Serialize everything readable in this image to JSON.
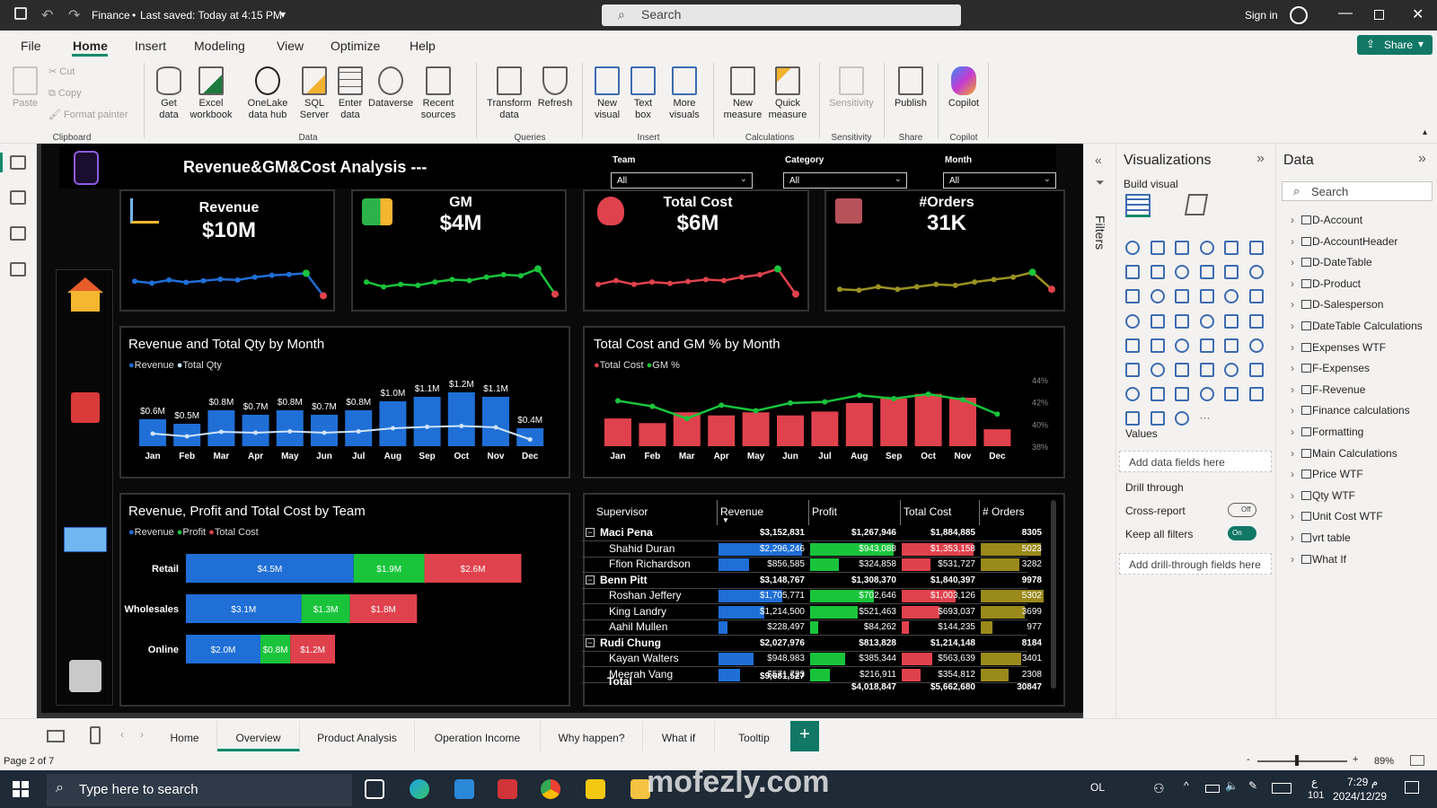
{
  "window": {
    "title": "Finance",
    "saved_status": "Last saved: Today at 4:15 PM",
    "search_placeholder": "Search",
    "signin": "Sign in"
  },
  "menu": [
    "File",
    "Home",
    "Insert",
    "Modeling",
    "View",
    "Optimize",
    "Help"
  ],
  "share_label": "Share",
  "ribbon": {
    "clipboard": {
      "paste": "Paste",
      "cut": "Cut",
      "copy": "Copy",
      "format_painter": "Format painter",
      "group": "Clipboard"
    },
    "data": {
      "get_data": "Get data",
      "excel": "Excel workbook",
      "onelake": "OneLake data hub",
      "sql": "SQL Server",
      "enter": "Enter data",
      "dataverse": "Dataverse",
      "recent": "Recent sources",
      "group": "Data"
    },
    "queries": {
      "transform": "Transform data",
      "refresh": "Refresh",
      "group": "Queries"
    },
    "insert": {
      "new_visual": "New visual",
      "text_box": "Text box",
      "more_visuals": "More visuals",
      "group": "Insert"
    },
    "calculations": {
      "new_measure": "New measure",
      "quick_measure": "Quick measure",
      "group": "Calculations"
    },
    "sensitivity": {
      "label": "Sensitivity",
      "group": "Sensitivity"
    },
    "share": {
      "publish": "Publish",
      "group": "Share"
    },
    "copilot": {
      "label": "Copilot",
      "group": "Copilot"
    }
  },
  "report": {
    "title": "Revenue&GM&Cost Analysis ---",
    "slicers": [
      {
        "label": "Team",
        "value": "All"
      },
      {
        "label": "Category",
        "value": "All"
      },
      {
        "label": "Month",
        "value": "All"
      }
    ],
    "kpis": [
      {
        "label": "Revenue",
        "value": "$10M",
        "color": "#1f6fd6",
        "trend": [
          0.45,
          0.4,
          0.48,
          0.42,
          0.46,
          0.5,
          0.48,
          0.55,
          0.6,
          0.62,
          0.65,
          0.08
        ]
      },
      {
        "label": "GM",
        "value": "$4M",
        "color": "#19c43b",
        "trend": [
          0.35,
          0.25,
          0.3,
          0.28,
          0.35,
          0.4,
          0.38,
          0.45,
          0.5,
          0.48,
          0.62,
          0.1
        ]
      },
      {
        "label": "Total Cost",
        "value": "$6M",
        "color": "#e0424d",
        "trend": [
          0.3,
          0.38,
          0.3,
          0.35,
          0.32,
          0.36,
          0.4,
          0.38,
          0.45,
          0.5,
          0.62,
          0.1
        ]
      },
      {
        "label": "#Orders",
        "value": "31K",
        "color": "#9a9222",
        "trend": [
          0.2,
          0.18,
          0.25,
          0.2,
          0.25,
          0.3,
          0.28,
          0.35,
          0.4,
          0.45,
          0.55,
          0.2
        ]
      }
    ],
    "months": [
      "Jan",
      "Feb",
      "Mar",
      "Apr",
      "May",
      "Jun",
      "Jul",
      "Aug",
      "Sep",
      "Oct",
      "Nov",
      "Dec"
    ]
  },
  "chart_data": [
    {
      "type": "bar",
      "title": "Revenue and Total Qty by Month",
      "categories": [
        "Jan",
        "Feb",
        "Mar",
        "Apr",
        "May",
        "Jun",
        "Jul",
        "Aug",
        "Sep",
        "Oct",
        "Nov",
        "Dec"
      ],
      "series": [
        {
          "name": "Revenue",
          "values": [
            0.6,
            0.5,
            0.8,
            0.7,
            0.8,
            0.7,
            0.8,
            1.0,
            1.1,
            1.2,
            1.1,
            0.4
          ],
          "labels": [
            "$0.6M",
            "$0.5M",
            "$0.8M",
            "$0.7M",
            "$0.8M",
            "$0.7M",
            "$0.8M",
            "$1.0M",
            "$1.1M",
            "$1.2M",
            "$1.1M",
            "$0.4M"
          ],
          "color": "#1f6fd6"
        },
        {
          "name": "Total Qty",
          "values": [
            0.28,
            0.22,
            0.32,
            0.3,
            0.33,
            0.3,
            0.33,
            0.4,
            0.43,
            0.45,
            0.42,
            0.15
          ],
          "color": "#cfe4ff"
        }
      ],
      "legend": "top-left"
    },
    {
      "type": "bar",
      "title": "Total Cost and GM % by Month",
      "categories": [
        "Jan",
        "Feb",
        "Mar",
        "Apr",
        "May",
        "Jun",
        "Jul",
        "Aug",
        "Sep",
        "Oct",
        "Nov",
        "Dec"
      ],
      "series": [
        {
          "name": "Total Cost",
          "values": [
            0.36,
            0.3,
            0.44,
            0.4,
            0.44,
            0.4,
            0.45,
            0.56,
            0.62,
            0.68,
            0.63,
            0.22
          ],
          "color": "#e0424d"
        },
        {
          "name": "GM %",
          "values": [
            42.1,
            41.6,
            40.5,
            41.7,
            41.2,
            41.9,
            42.0,
            42.6,
            42.3,
            42.7,
            42.2,
            40.9
          ],
          "color": "#19c43b"
        }
      ],
      "y2_ticks": [
        "44%",
        "42%",
        "40%",
        "38%"
      ],
      "y2lim": [
        38,
        44
      ],
      "legend": "top-left"
    },
    {
      "type": "bar",
      "title": "Revenue, Profit and Total Cost by Team",
      "categories": [
        "Retail",
        "Wholesales",
        "Online"
      ],
      "series": [
        {
          "name": "Revenue",
          "values": [
            4.5,
            3.1,
            2.0
          ],
          "labels": [
            "$4.5M",
            "$3.1M",
            "$2.0M"
          ],
          "color": "#1f6fd6"
        },
        {
          "name": "Profit",
          "values": [
            1.9,
            1.3,
            0.8
          ],
          "labels": [
            "$1.9M",
            "$1.3M",
            "$0.8M"
          ],
          "color": "#19c43b"
        },
        {
          "name": "Total Cost",
          "values": [
            2.6,
            1.8,
            1.2
          ],
          "labels": [
            "$2.6M",
            "$1.8M",
            "$1.2M"
          ],
          "color": "#e0424d"
        }
      ],
      "orientation": "horizontal-stacked",
      "legend": "top-left"
    }
  ],
  "matrix": {
    "headers": [
      "Supervisor",
      "Revenue",
      "Profit",
      "Total Cost",
      "# Orders"
    ],
    "rows": [
      {
        "name": "Maci Pena",
        "level": 0,
        "revenue": "$3,152,831",
        "profit": "$1,267,946",
        "cost": "$1,884,885",
        "orders": "8305"
      },
      {
        "name": "Shahid Duran",
        "level": 1,
        "revenue": "$2,296,246",
        "profit": "$943,088",
        "cost": "$1,353,158",
        "orders": "5023",
        "rv": 0.95,
        "pv": 0.95,
        "cv": 0.95,
        "ov": 0.95
      },
      {
        "name": "Ffion Richardson",
        "level": 1,
        "revenue": "$856,585",
        "profit": "$324,858",
        "cost": "$531,727",
        "orders": "3282",
        "rv": 0.35,
        "pv": 0.33,
        "cv": 0.38,
        "ov": 0.62
      },
      {
        "name": "Benn Pitt",
        "level": 0,
        "revenue": "$3,148,767",
        "profit": "$1,308,370",
        "cost": "$1,840,397",
        "orders": "9978"
      },
      {
        "name": "Roshan Jeffery",
        "level": 1,
        "revenue": "$1,705,771",
        "profit": "$702,646",
        "cost": "$1,003,126",
        "orders": "5302",
        "rv": 0.72,
        "pv": 0.72,
        "cv": 0.72,
        "ov": 1.0
      },
      {
        "name": "King Landry",
        "level": 1,
        "revenue": "$1,214,500",
        "profit": "$521,463",
        "cost": "$693,037",
        "orders": "3699",
        "rv": 0.52,
        "pv": 0.54,
        "cv": 0.5,
        "ov": 0.7
      },
      {
        "name": "Aahil Mullen",
        "level": 1,
        "revenue": "$228,497",
        "profit": "$84,262",
        "cost": "$144,235",
        "orders": "977",
        "rv": 0.1,
        "pv": 0.09,
        "cv": 0.1,
        "ov": 0.18
      },
      {
        "name": "Rudi Chung",
        "level": 0,
        "revenue": "$2,027,976",
        "profit": "$813,828",
        "cost": "$1,214,148",
        "orders": "8184"
      },
      {
        "name": "Kayan Walters",
        "level": 1,
        "revenue": "$948,983",
        "profit": "$385,344",
        "cost": "$563,639",
        "orders": "3401",
        "rv": 0.4,
        "pv": 0.4,
        "cv": 0.4,
        "ov": 0.64
      },
      {
        "name": "Meerah Vang",
        "level": 1,
        "revenue": "$571,723",
        "profit": "$216,911",
        "cost": "$354,812",
        "orders": "2308",
        "rv": 0.24,
        "pv": 0.22,
        "cv": 0.25,
        "ov": 0.44
      }
    ],
    "total": {
      "name": "Total",
      "revenue": "$9,681,527",
      "profit": "$4,018,847",
      "cost": "$5,662,680",
      "orders": "30847"
    }
  },
  "viz_pane": {
    "title": "Visualizations",
    "build_visual": "Build visual",
    "values_label": "Values",
    "add_fields": "Add data fields here",
    "drill_through": "Drill through",
    "cross_report": "Cross-report",
    "cross_report_state": "Off",
    "keep_filters": "Keep all filters",
    "keep_filters_state": "On",
    "add_drill": "Add drill-through fields here"
  },
  "filters_label": "Filters",
  "data_pane": {
    "title": "Data",
    "search_placeholder": "Search",
    "tables": [
      "D-Account",
      "D-AccountHeader",
      "D-DateTable",
      "D-Product",
      "D-Salesperson",
      "DateTable Calculations",
      "Expenses WTF",
      "F-Expenses",
      "F-Revenue",
      "Finance calculations",
      "Formatting",
      "Main Calculations",
      "Price WTF",
      "Qty WTF",
      "Unit Cost WTF",
      "vrt table",
      "What If"
    ]
  },
  "pages": [
    "Home",
    "Overview",
    "Product Analysis",
    "Operation Income",
    "Why happen?",
    "What if",
    "Tooltip"
  ],
  "status": {
    "page": "Page 2 of 7",
    "zoom": "89%"
  },
  "taskbar": {
    "search_placeholder": "Type here to search",
    "lang": "OL",
    "time": "7:29 م",
    "date": "2024/12/29",
    "kbd": "ع",
    "kbd2": "101"
  },
  "watermark": "mofezly.com"
}
